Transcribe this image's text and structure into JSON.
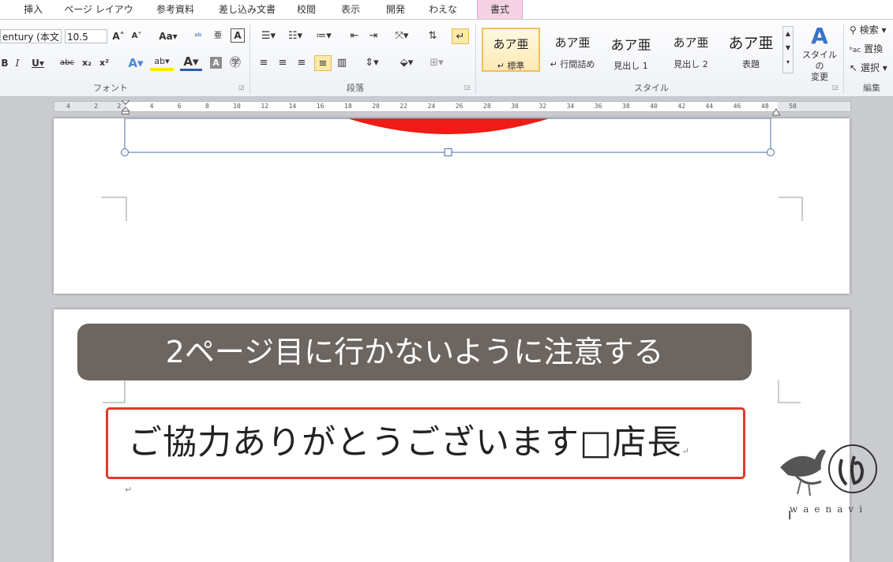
{
  "tabs": [
    {
      "label": "挿入"
    },
    {
      "label": "ページ レイアウト"
    },
    {
      "label": "参考資料"
    },
    {
      "label": "差し込み文書"
    },
    {
      "label": "校閲"
    },
    {
      "label": "表示"
    },
    {
      "label": "開発"
    },
    {
      "label": "わえなび"
    },
    {
      "label": "書式"
    }
  ],
  "ribbon": {
    "font": {
      "font_name": "entury (本文",
      "font_size": "10.5",
      "group_label": "フォント"
    },
    "paragraph": {
      "group_label": "段落"
    },
    "styles": {
      "group_label": "スタイル",
      "sample": "あア亜",
      "title_sample": "あア亜",
      "items": [
        {
          "name": "↵ 標準"
        },
        {
          "name": "↵ 行間詰め"
        },
        {
          "name": "見出し 1"
        },
        {
          "name": "見出し 2"
        },
        {
          "name": "表題"
        }
      ],
      "change_styles_label": "スタイルの\n変更"
    },
    "editing": {
      "group_label": "編集",
      "find": "検索",
      "replace": "置換",
      "select": "選択"
    }
  },
  "ruler": {
    "ticks": [
      "4",
      "2",
      "2",
      "4",
      "6",
      "8",
      "10",
      "12",
      "14",
      "16",
      "18",
      "20",
      "22",
      "24",
      "26",
      "28",
      "30",
      "32",
      "34",
      "36",
      "38",
      "40",
      "42",
      "44",
      "46",
      "48",
      "50"
    ]
  },
  "document": {
    "banner_text": "2ページ目に行かないように注意する",
    "body_text": "ご協力ありがとうございます□店長",
    "paragraph_mark": "↵"
  },
  "watermark": {
    "text": "waenavi"
  },
  "colors": {
    "highlight_red": "#e0392b",
    "banner_gray": "#6c6560",
    "shape_red": "#ee1c16",
    "selected_tab": "#f5d2e3"
  }
}
